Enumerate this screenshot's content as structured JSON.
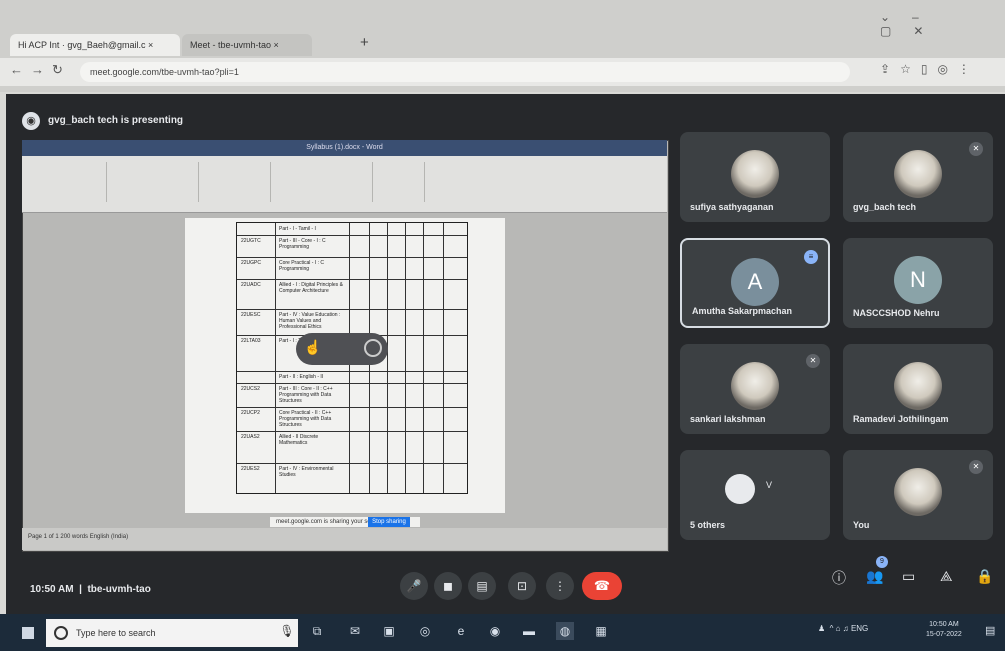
{
  "browser": {
    "tabs": [
      {
        "label": "Hi ACP Int · gvg_Baeh@gmail.c ×"
      },
      {
        "label": "Meet - tbe-uvmh-tao ×"
      }
    ],
    "new_tab": "+",
    "url": "meet.google.com/tbe-uvmh-tao?pli=1"
  },
  "meet": {
    "presenter_banner": "gvg_bach tech is presenting",
    "meeting_time": "10:50 AM",
    "meeting_code": "tbe-uvmh-tao",
    "share_notice": "meet.google.com is sharing your screen",
    "stop_sharing_label": "Stop sharing",
    "participants": [
      {
        "name": "sufiya sathyaganan",
        "avatar_type": "photo"
      },
      {
        "name": "gvg_bach tech",
        "avatar_type": "photo"
      },
      {
        "name": "Amutha Sakarpmachan",
        "initial": "A",
        "avatar_color": "#7a8f9c",
        "avatar_type": "initial"
      },
      {
        "name": "NASCCSHOD Nehru",
        "initial": "N",
        "avatar_color": "#8aa3a8",
        "avatar_type": "initial"
      },
      {
        "name": "sankari lakshman",
        "avatar_type": "photo"
      },
      {
        "name": "Ramadevi Jothilingam",
        "avatar_type": "photo"
      },
      {
        "name": "5 others",
        "avatar_type": "group"
      },
      {
        "name": "You",
        "avatar_type": "photo"
      }
    ],
    "people_count": "9",
    "controls": [
      "mic-icon",
      "camera-icon",
      "captions-icon",
      "present-icon",
      "more-icon"
    ],
    "right_controls": [
      "info-icon",
      "people-icon",
      "chat-icon",
      "activities-icon",
      "host-controls-icon"
    ]
  },
  "shared_screen": {
    "app_title": "Syllabus (1).docx - Word",
    "status_bar": "Page 1 of 1   200 words   English (India)",
    "table_rows": [
      {
        "code": "",
        "title": "Part - I - Tamil - I"
      },
      {
        "code": "22UGTC",
        "title": "Part - III - Core - I : C Programming"
      },
      {
        "code": "22UGPC",
        "title": "Core Practical - I : C Programming"
      },
      {
        "code": "22UADC",
        "title": "Allied - I : Digital Principles & Computer Architecture"
      },
      {
        "code": "22UESC",
        "title": "Part - IV : Value Education : Human Values and Professional Ethics"
      },
      {
        "code": "22LTA03",
        "title": "Part - I : Tamil - II"
      },
      {
        "code": "",
        "title": "Part - II : English - II"
      },
      {
        "code": "22UCS2",
        "title": "Part - III : Core - II : C++ Programming with Data Structures"
      },
      {
        "code": "22UCP2",
        "title": "Core Practical - II : C++ Programming with Data Structures"
      },
      {
        "code": "22UAS2",
        "title": "Allied - II Discrete Mathematics"
      },
      {
        "code": "22UES2",
        "title": "Part - IV : Environmental Studies"
      }
    ]
  },
  "taskbar": {
    "search_placeholder": "Type here to search",
    "tray_lang": "ENG",
    "clock_time": "10:50 AM",
    "clock_date": "15-07-2022"
  }
}
